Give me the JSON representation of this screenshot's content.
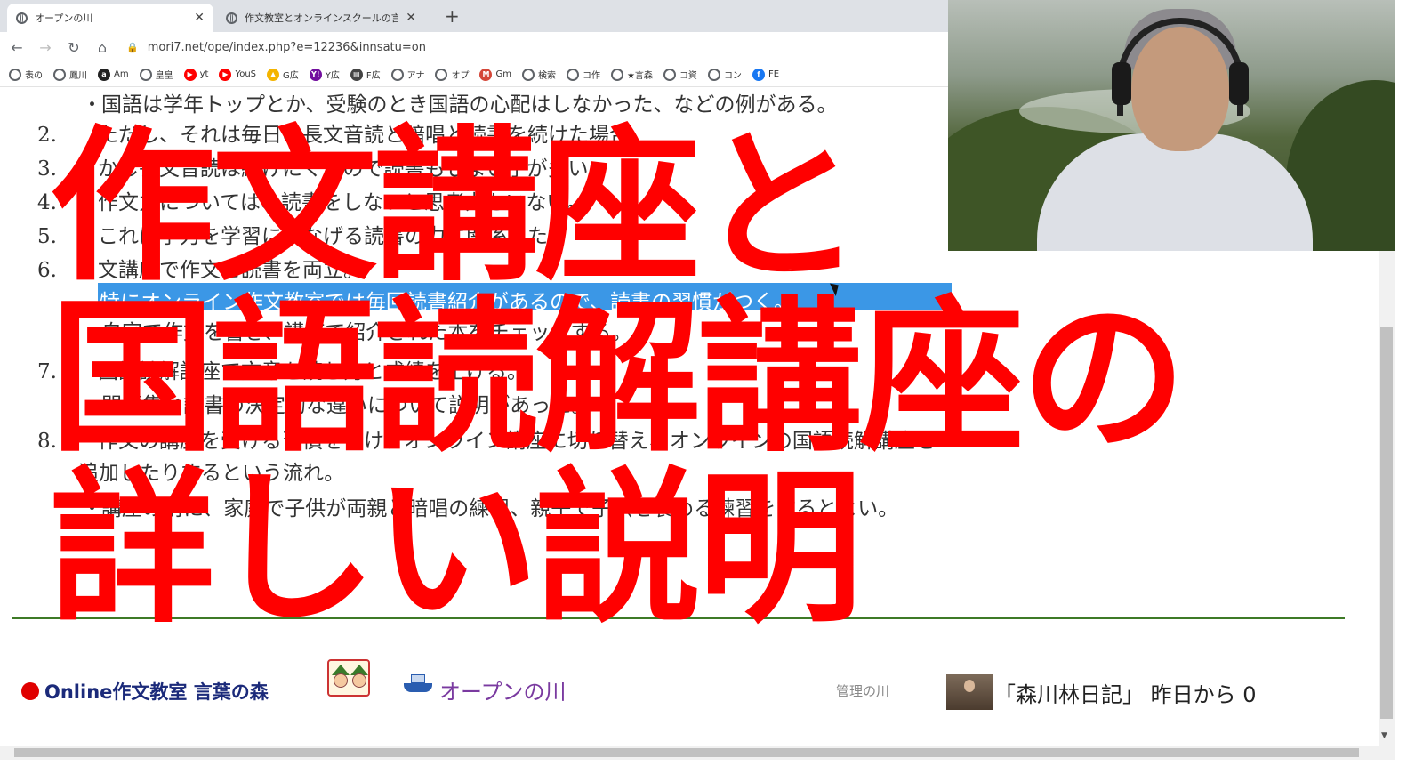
{
  "browser": {
    "tabs": [
      {
        "title": "オープンの川",
        "active": true
      },
      {
        "title": "作文教室とオンラインスクールの言葉",
        "active": false
      }
    ],
    "new_tab": "+",
    "close_glyph": "✕",
    "url": "mori7.net/ope/index.php?e=12236&innsatu=on",
    "bookmarks": [
      {
        "label": "表の",
        "icon": "globe-icon",
        "color": "#5f6368"
      },
      {
        "label": "鳳川",
        "icon": "globe-icon",
        "color": "#5f6368"
      },
      {
        "label": "Am",
        "icon": "amazon-icon",
        "color": "#222222"
      },
      {
        "label": "皇皇",
        "icon": "globe-icon",
        "color": "#5f6368"
      },
      {
        "label": "yt",
        "icon": "youtube-icon",
        "color": "#ff0000"
      },
      {
        "label": "YouS",
        "icon": "youtube-icon",
        "color": "#ff0000"
      },
      {
        "label": "G広",
        "icon": "google-ads-icon",
        "color": "#f4b400"
      },
      {
        "label": "Y広",
        "icon": "yahoo-icon",
        "color": "#720e9e"
      },
      {
        "label": "F広",
        "icon": "doc-icon",
        "color": "#444444"
      },
      {
        "label": "アナ",
        "icon": "globe-icon",
        "color": "#5f6368"
      },
      {
        "label": "オプ",
        "icon": "globe-icon",
        "color": "#5f6368"
      },
      {
        "label": "Gm",
        "icon": "gmail-icon",
        "color": "#d44638"
      },
      {
        "label": "検索",
        "icon": "globe-icon",
        "color": "#5f6368"
      },
      {
        "label": "コ作",
        "icon": "globe-icon",
        "color": "#5f6368"
      },
      {
        "label": "★言森",
        "icon": "globe-icon",
        "color": "#5f6368"
      },
      {
        "label": "コ資",
        "icon": "globe-icon",
        "color": "#5f6368"
      },
      {
        "label": "コン",
        "icon": "globe-icon",
        "color": "#5f6368"
      },
      {
        "label": "FE",
        "icon": "facebook-icon",
        "color": "#1877f2"
      }
    ]
  },
  "doc": {
    "lines": [
      {
        "num": "",
        "bullet": "・",
        "text": "国語は学年トップとか、受験のとき国語の心配はしなかった、などの例がある。"
      },
      {
        "num": "2.",
        "bullet": "",
        "text": "ただし、それは毎日の長文音読と暗唱と読書を続けた場合。"
      },
      {
        "num": "3.",
        "bullet": "",
        "text": "かし長文音読は続けにくいので読書もしまい子が多い。"
      },
      {
        "num": "4.",
        "bullet": "",
        "text": "作文力については、読書をしないと思考力もいない。"
      },
      {
        "num": "5.",
        "bullet": "",
        "text": "これは学力を学習につなげる読書の力に関係した。"
      },
      {
        "num": "6.",
        "bullet": "",
        "text": "文講座で作文と読書を両立。"
      },
      {
        "num": "",
        "bullet": "・",
        "text": "自宅で作文を書き、講座で紹介された本をチェックする。"
      },
      {
        "num": "7.",
        "bullet": "",
        "text": "国語読解講座で文章を読む力と成績を上げる。"
      },
      {
        "num": "",
        "bullet": "・",
        "text": "問題集と読書の決定的な違いについて説明があった。"
      },
      {
        "num": "8.",
        "bullet": "",
        "text": "作文の講座を受ける習慣をつけ、オンライン講座に切り替え、オンラインの国語読解講座を"
      },
      {
        "num": "",
        "bullet": "",
        "text": "追加したりするという流れ。"
      },
      {
        "num": "",
        "bullet": "・",
        "text": "講座の前に、家庭で子供が両親と暗唱の練習、親子で子供を褒める練習をするとよい。"
      }
    ],
    "highlighted": "特にオンライン作文教室では毎回読書紹介があるので、読書の習慣がつく。"
  },
  "footer": {
    "brand": "Online作文教室 言葉の森",
    "river": "オープンの川",
    "admin": "管理の川",
    "diary": "「森川林日記」 昨日から 0"
  },
  "caption": {
    "line1": "作文講座と",
    "line2": "国語読解講座の",
    "line3": "詳しい説明"
  },
  "colors": {
    "caption": "#ff0000",
    "highlight": "#3b97e6",
    "divider": "#3e7a26",
    "brand_text": "#1b2a7a",
    "river_text": "#7a3aa0"
  }
}
